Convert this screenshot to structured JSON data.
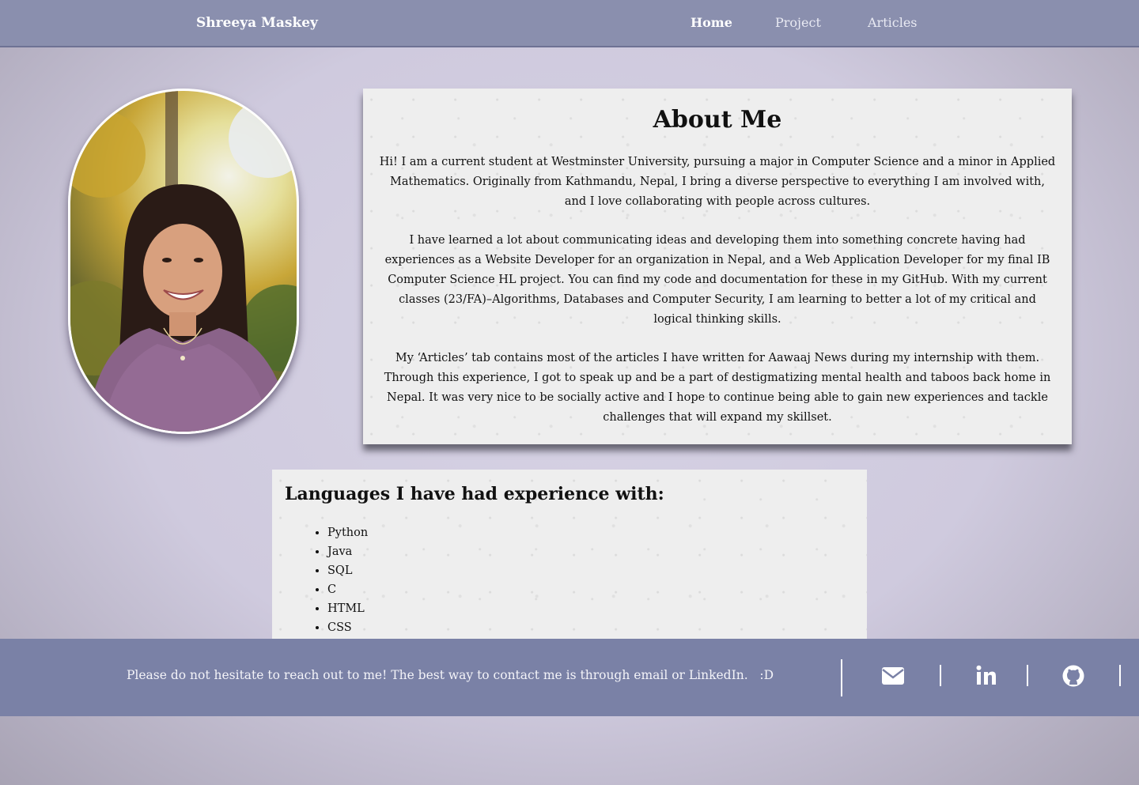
{
  "nav": {
    "brand": "Shreeya Maskey",
    "links": [
      {
        "label": "Home",
        "active": true
      },
      {
        "label": "Project",
        "active": false
      },
      {
        "label": "Articles",
        "active": false
      }
    ]
  },
  "profile_photo": {
    "icon": "profile-photo"
  },
  "about": {
    "title": "About Me",
    "paragraphs": [
      "Hi! I am a current student at Westminster University, pursuing a major in Computer Science and a minor in Applied Mathematics. Originally from Kathmandu, Nepal, I bring a diverse perspective to everything I am involved with, and I love collaborating with people across cultures.",
      "I have learned a lot about communicating ideas and developing them into something concrete having had experiences as a Website Developer for an organization in Nepal, and a Web Application Developer for my final IB Computer Science HL project. You can find my code and documentation for these in my GitHub. With my current classes (23/FA)–Algorithms, Databases and Computer Security, I am learning to better a lot of my critical and logical thinking skills.",
      "My ‘Articles’ tab contains most of the articles I have written for Aawaaj News during my internship with them. Through this experience, I got to speak up and be a part of destigmatizing mental health and taboos back home in Nepal. It was very nice to be socially active and I hope to continue being able to gain new experiences and tackle challenges that will expand my skillset."
    ]
  },
  "languages": {
    "title": "Languages I have had experience with:",
    "items": [
      "Python",
      "Java",
      "SQL",
      "C",
      "HTML",
      "CSS"
    ]
  },
  "footer": {
    "text": "Please do not hesitate to reach out to me! The best way to contact me is through email or LinkedIn.   :D",
    "icons": [
      "envelope-icon",
      "linkedin-icon",
      "github-icon"
    ]
  },
  "colors": {
    "navbar": "#8a8fae",
    "footer": "#7a81a6",
    "background": "#cfcade",
    "card": "#eeeeee"
  }
}
